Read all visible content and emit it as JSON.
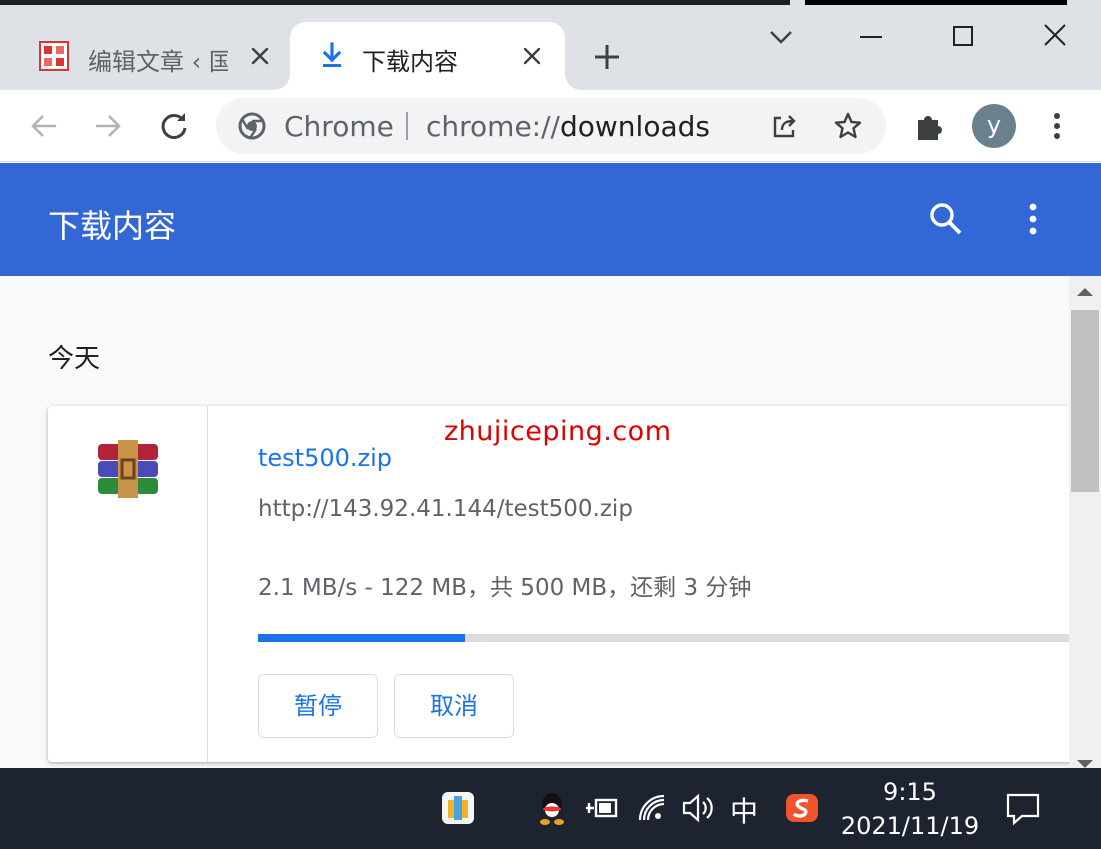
{
  "browser": {
    "tabs": [
      {
        "title": "编辑文章 ‹ 国",
        "active": false,
        "icon": "site-favicon"
      },
      {
        "title": "下载内容",
        "active": true,
        "icon": "download-icon"
      }
    ],
    "window_controls": [
      "minimize-icon",
      "maximize-icon",
      "close-icon"
    ],
    "toolbar": {
      "site_name": "Chrome",
      "url_scheme": "chrome://",
      "url_path": "downloads",
      "avatar_letter": "y"
    }
  },
  "page": {
    "header_title": "下载内容",
    "section_date": "今天",
    "watermark": "zhujiceping.com",
    "download": {
      "file_name": "test500.zip",
      "url": "http://143.92.41.144/test500.zip",
      "status": "2.1 MB/s - 122 MB，共 500 MB，还剩 3 分钟",
      "progress_fraction": 0.244,
      "pause_label": "暂停",
      "cancel_label": "取消",
      "file_icon": "winrar-archive-icon"
    }
  },
  "taskbar": {
    "ime_label": "中",
    "time": "9:15",
    "date": "2021/11/19",
    "tray_icons": [
      "winrar-tray-icon",
      "qq-icon",
      "power-icon",
      "wifi-icon",
      "volume-icon",
      "sogou-icon",
      "notification-icon"
    ]
  },
  "colors": {
    "header_blue": "#3367d6",
    "link_blue": "#1a73e8",
    "watermark_red": "#e00000",
    "taskbar_bg": "#1d2430"
  }
}
